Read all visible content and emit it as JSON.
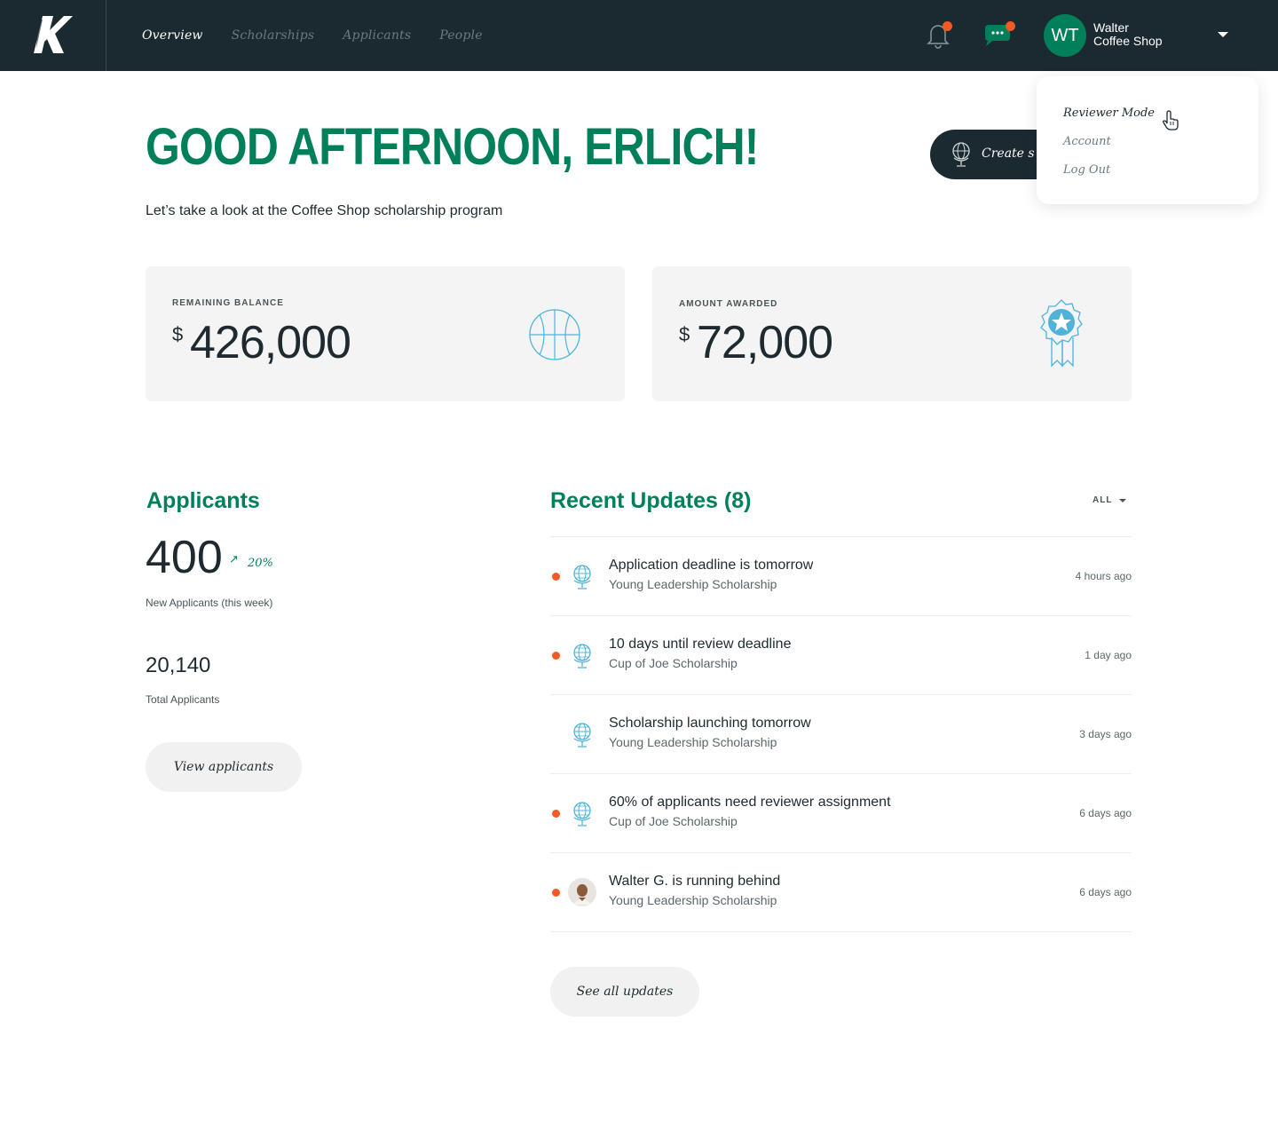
{
  "nav": {
    "logo_letter": "K",
    "items": [
      {
        "label": "Overview",
        "active": true
      },
      {
        "label": "Scholarships",
        "active": false
      },
      {
        "label": "Applicants",
        "active": false
      },
      {
        "label": "People",
        "active": false
      }
    ]
  },
  "header_icons": {
    "notifications": {
      "icon": "bell-icon",
      "has_unread": true
    },
    "messages": {
      "icon": "chat-bubble-icon",
      "has_unread": true
    }
  },
  "user": {
    "initials": "WT",
    "name": "Walter",
    "organization": "Coffee Shop"
  },
  "user_menu": {
    "items": [
      "Reviewer Mode",
      "Account",
      "Log Out"
    ],
    "hovered": "Reviewer Mode"
  },
  "hero": {
    "greeting": "GOOD AFTERNOON, ERLICH!",
    "subtitle": "Let’s take a look at the Coffee Shop scholarship program",
    "create_button_label": "Create s"
  },
  "stats": [
    {
      "label": "REMAINING BALANCE",
      "currency": "$",
      "value": "426,000",
      "icon": "basketball-icon"
    },
    {
      "label": "AMOUNT AWARDED",
      "currency": "$",
      "value": "72,000",
      "icon": "award-ribbon-icon"
    }
  ],
  "applicants": {
    "title": "Applicants",
    "new_count": "400",
    "trend_arrow": "↗",
    "trend_pct": "20%",
    "new_label": "New Applicants (this week)",
    "total_count": "20,140",
    "total_label": "Total Applicants",
    "view_button": "View applicants"
  },
  "updates": {
    "title": "Recent Updates (8)",
    "filter": "ALL",
    "items": [
      {
        "title": "Application deadline is tomorrow",
        "subtitle": "Young Leadership Scholarship",
        "time": "4 hours ago",
        "unread": true,
        "icon": "globe-icon"
      },
      {
        "title": "10 days until review deadline",
        "subtitle": "Cup of Joe Scholarship",
        "time": "1 day ago",
        "unread": true,
        "icon": "globe-icon"
      },
      {
        "title": "Scholarship launching tomorrow",
        "subtitle": "Young Leadership Scholarship",
        "time": "3 days ago",
        "unread": false,
        "icon": "globe-icon"
      },
      {
        "title": "60% of applicants need reviewer assignment",
        "subtitle": "Cup of Joe Scholarship",
        "time": "6 days ago",
        "unread": true,
        "icon": "globe-icon"
      },
      {
        "title": "Walter G. is running behind",
        "subtitle": "Young Leadership Scholarship",
        "time": "6 days ago",
        "unread": true,
        "icon": "user-photo"
      }
    ],
    "see_all": "See all updates"
  },
  "colors": {
    "brand_green": "#00805a",
    "nav_bg": "#1b2a31",
    "alert_orange": "#f15a22",
    "icon_blue": "#4fb3d9"
  }
}
